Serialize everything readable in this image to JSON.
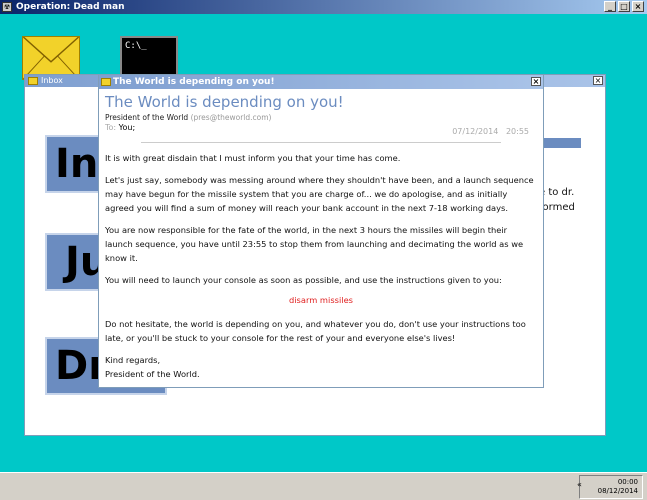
{
  "app": {
    "title": "Operation: Dead man"
  },
  "desktop": {
    "console_text": "C:\\_"
  },
  "inbox_window": {
    "title": "Inbox",
    "folders": [
      "Inb",
      "Ju",
      "Drafts"
    ],
    "side_text_lines": [
      "e to dr.",
      "formed"
    ]
  },
  "email": {
    "window_title": "The World is depending on you!",
    "subject": "The World is depending on you!",
    "from_name": "President of the World",
    "from_addr": "(pres@theworld.com)",
    "date": "07/12/2014",
    "time": "20:55",
    "to_label": "To:",
    "to_value": "You;",
    "paragraphs": [
      "It is with great disdain that I must inform you that your time has come.",
      "Let's just say, somebody was messing around where they shouldn't have been, and a launch sequence may have begun for the missile system that you are charge of... we do apologise, and as initially agreed you will find a sum of money will reach your bank account in the next 7-18 working days.",
      "You are now responsible for the fate of the world, in the next 3 hours the missiles will begin their launch sequence, you have until 23:55 to stop them from launching and decimating the world as we know it.",
      "You will need to launch your console as soon as possible, and use the instructions given to you:"
    ],
    "link_text": "disarm missiles",
    "paragraphs_after": [
      "Do not hesitate, the world is depending on you, and whatever you do, don't use your instructions too late, or you'll be stuck to your console for the rest of your and everyone else's lives!"
    ],
    "signoff": "Kind regards,",
    "signature": "President of the World."
  },
  "taskbar": {
    "tray_arrow": "«",
    "clock_time": "00:00",
    "clock_date": "08/12/2014"
  },
  "icons": {
    "minimize": "_",
    "maximize": "□",
    "close": "×"
  }
}
